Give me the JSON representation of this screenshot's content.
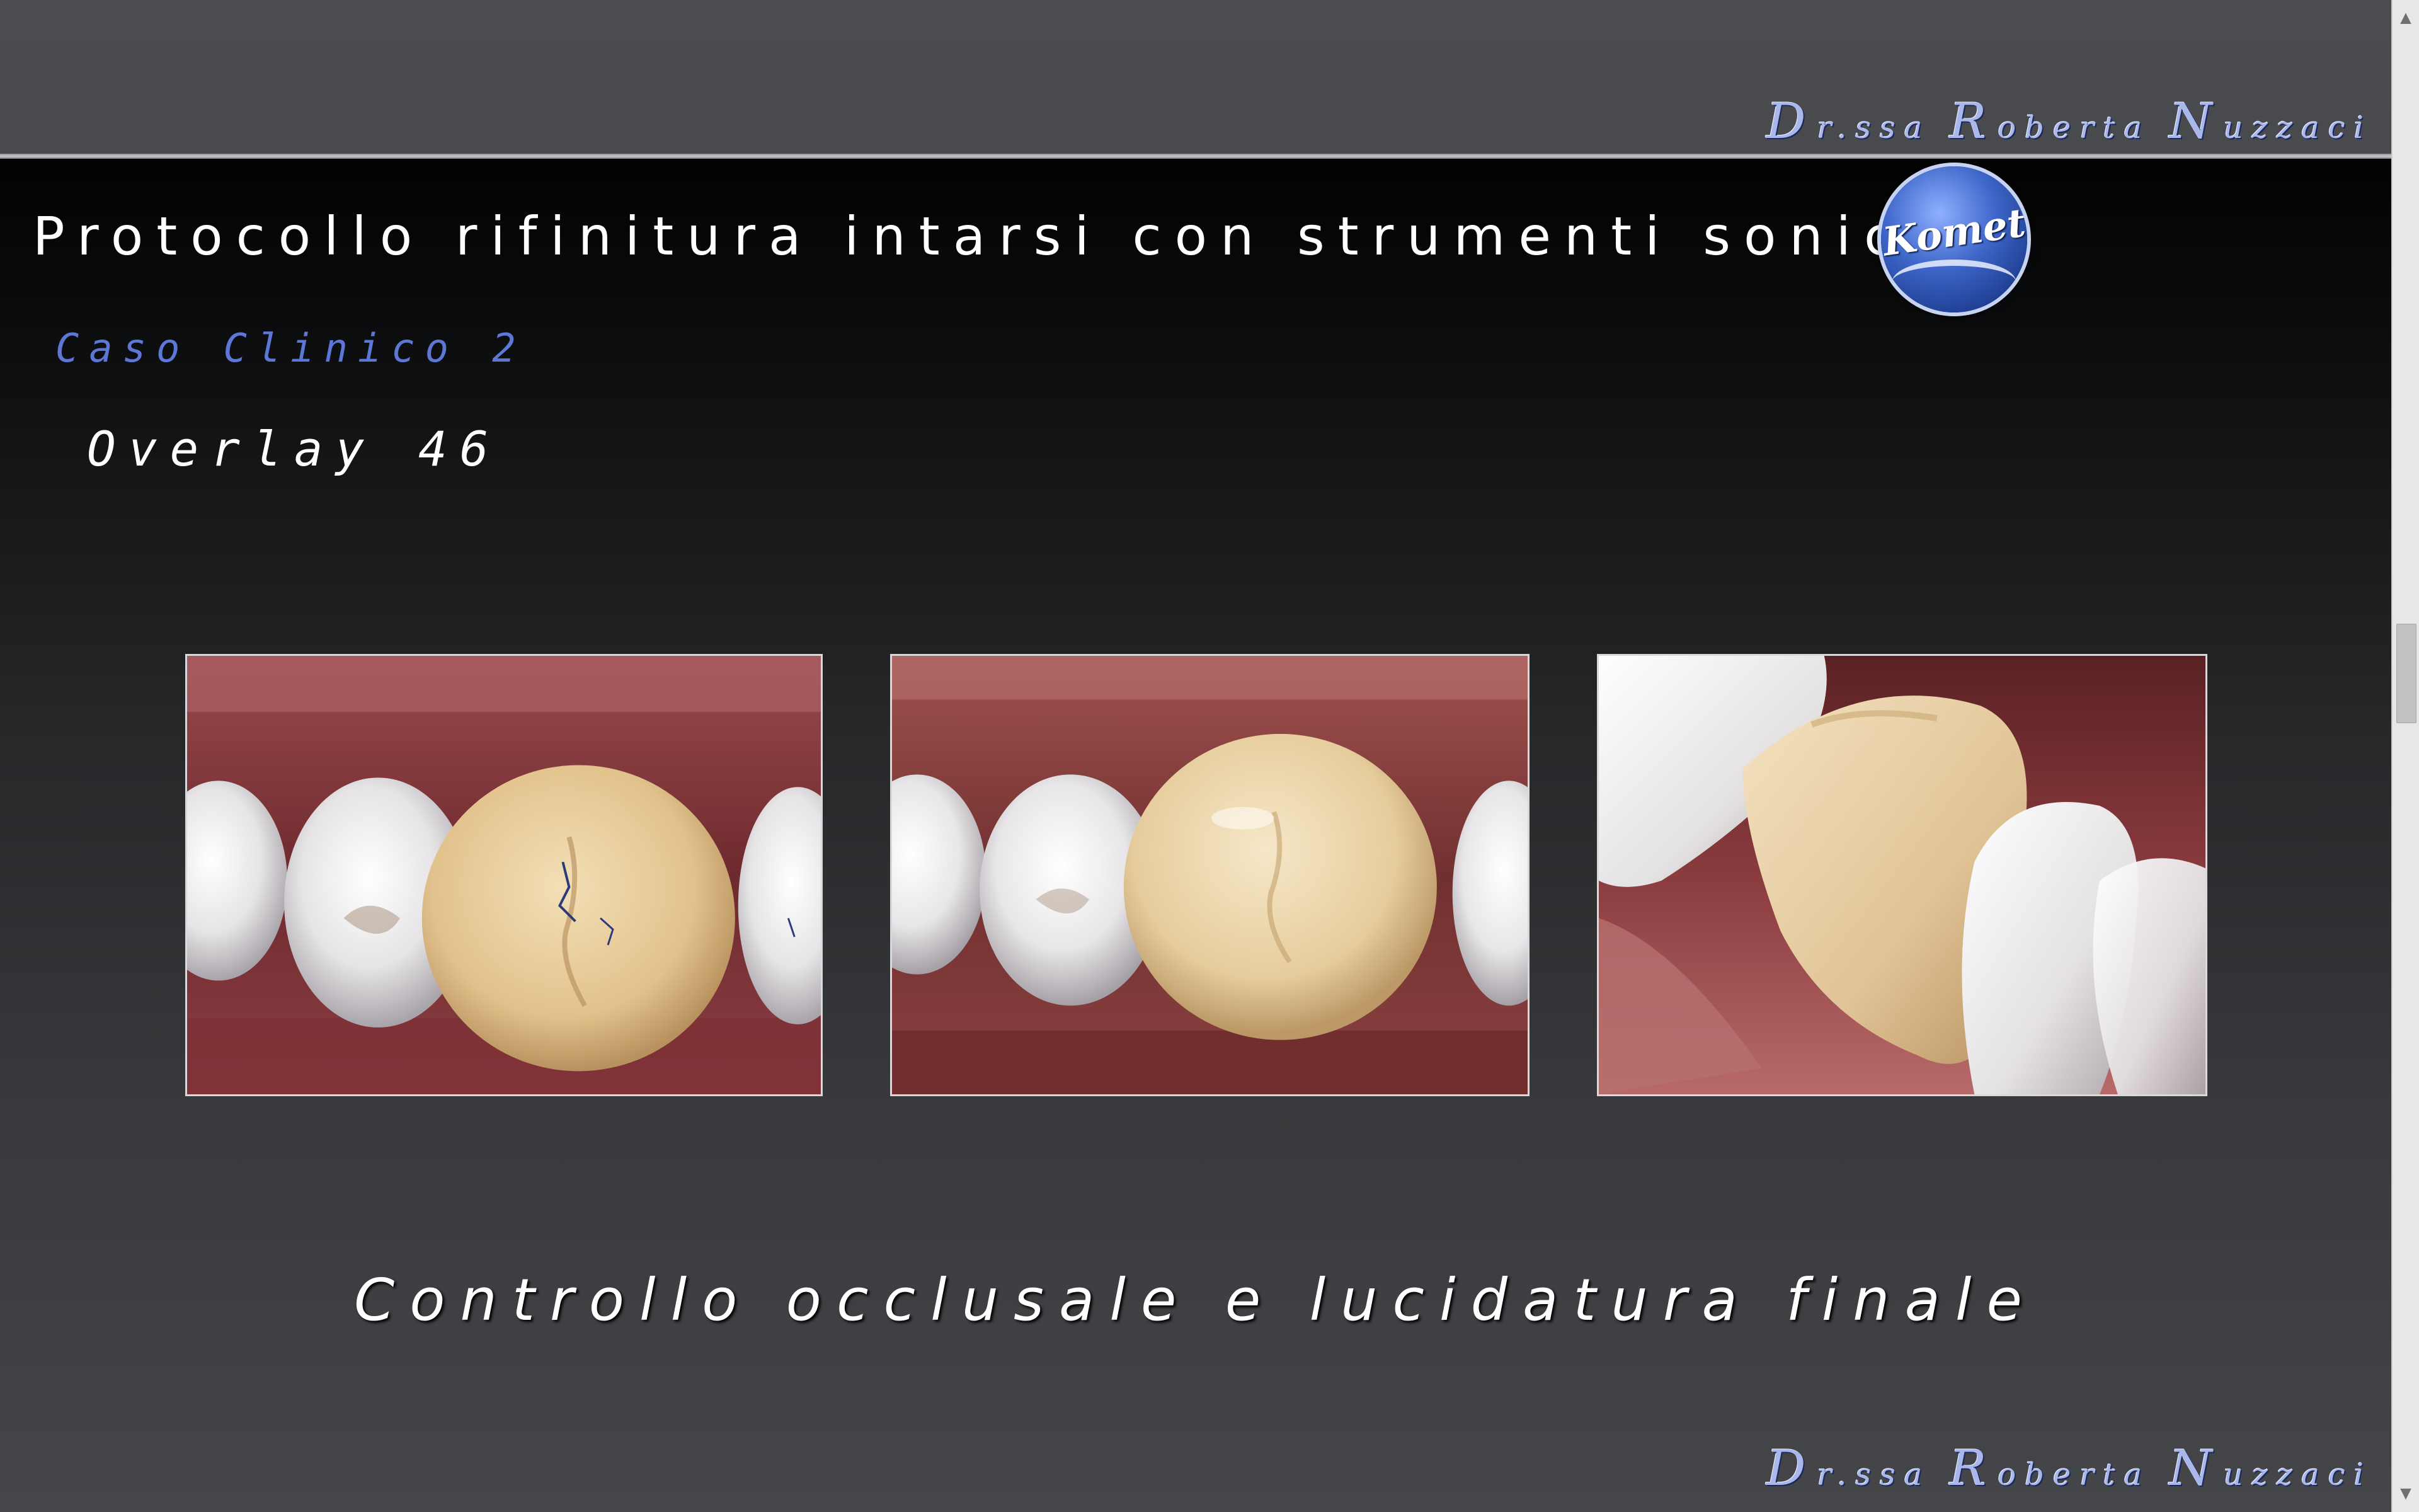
{
  "signature": {
    "initial_1": "D",
    "rest_1": "r.ssa",
    "initial_2": "R",
    "rest_2": "oberta",
    "initial_3": "N",
    "rest_3": "uzzaci"
  },
  "slide": {
    "title": "Protocollo rifinitura intarsi con strumenti sonici",
    "logo_text": "Komet",
    "case_label": "Caso Clinico 2",
    "case_subtitle": "Overlay 46",
    "caption": "Controllo occlusale e lucidatura finale"
  },
  "photos": [
    {
      "subject": "occlusal view of overlay 46 with articulating paper marks"
    },
    {
      "subject": "occlusal view of overlay 46 after polishing"
    },
    {
      "subject": "buccal view of overlay 46 after polishing"
    }
  ],
  "scrollbar": {
    "up_icon": "▲",
    "down_icon": "▼"
  },
  "colors": {
    "signature": "#a9b7ea",
    "case_label": "#5d77d6",
    "logo_blue": "#3e66c9",
    "background": "#4b4d51"
  }
}
